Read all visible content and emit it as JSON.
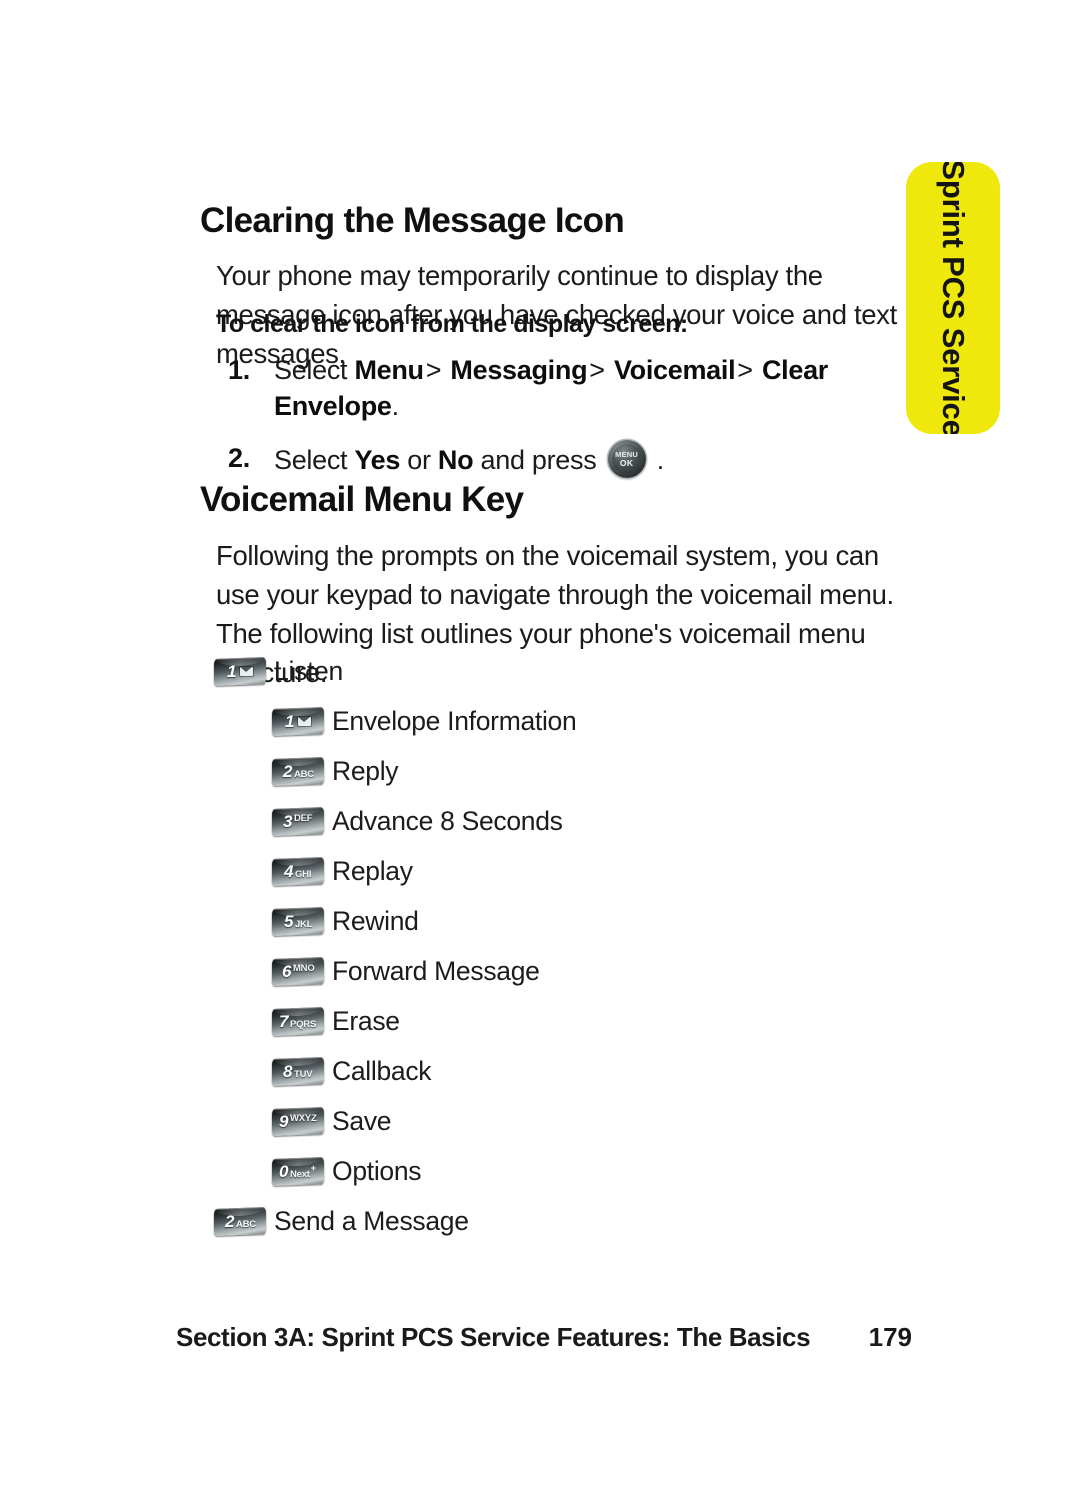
{
  "side_tab": {
    "label": "Sprint PCS Service",
    "background_color": "#efe80d",
    "text_color": "#141414"
  },
  "sections": {
    "clearing": {
      "heading": "Clearing the Message Icon",
      "paragraph": "Your phone may temporarily continue to display the message icon after you have checked your voice and text messages.",
      "lead_in": "To clear the icon from the display screen:",
      "steps": [
        {
          "number": "1.",
          "prefix": "Select ",
          "path": [
            "Menu",
            "Messaging",
            "Voicemail",
            "Clear Envelope"
          ],
          "separator": ">",
          "suffix": "."
        },
        {
          "number": "2.",
          "prefix": "Select ",
          "option_a": "Yes",
          "conjunction": " or ",
          "option_b": "No",
          "middle": " and press ",
          "key_icon": "menu-ok-key",
          "key_top_label": "MENU",
          "key_bottom_label": "OK",
          "suffix": " ."
        }
      ]
    },
    "voicemail": {
      "heading": "Voicemail Menu Key",
      "paragraph": "Following the prompts on the voicemail system, you can use your keypad to navigate through the voicemail menu. The following list outlines your phone's voicemail menu structure."
    }
  },
  "menu_tree": [
    {
      "level": 1,
      "key": {
        "digit": "1",
        "glyph": "envelope",
        "letters": ""
      },
      "label": "Listen"
    },
    {
      "level": 2,
      "key": {
        "digit": "1",
        "glyph": "envelope",
        "letters": ""
      },
      "label": "Envelope Information"
    },
    {
      "level": 2,
      "key": {
        "digit": "2",
        "glyph": "",
        "letters": "ABC"
      },
      "label": "Reply"
    },
    {
      "level": 2,
      "key": {
        "digit": "3",
        "glyph": "",
        "letters": "DEF",
        "raised": true
      },
      "label": "Advance 8 Seconds"
    },
    {
      "level": 2,
      "key": {
        "digit": "4",
        "glyph": "",
        "letters": "GHI"
      },
      "label": "Replay"
    },
    {
      "level": 2,
      "key": {
        "digit": "5",
        "glyph": "",
        "letters": "JKL"
      },
      "label": "Rewind"
    },
    {
      "level": 2,
      "key": {
        "digit": "6",
        "glyph": "",
        "letters": "MNO",
        "raised": true
      },
      "label": "Forward Message"
    },
    {
      "level": 2,
      "key": {
        "digit": "7",
        "glyph": "",
        "letters": "PQRS"
      },
      "label": "Erase"
    },
    {
      "level": 2,
      "key": {
        "digit": "8",
        "glyph": "",
        "letters": "TUV"
      },
      "label": "Callback"
    },
    {
      "level": 2,
      "key": {
        "digit": "9",
        "glyph": "",
        "letters": "WXYZ",
        "raised": true
      },
      "label": "Save"
    },
    {
      "level": 2,
      "key": {
        "digit": "0",
        "glyph": "",
        "letters": "Next",
        "plus": "+"
      },
      "label": "Options"
    },
    {
      "level": 1,
      "key": {
        "digit": "2",
        "glyph": "",
        "letters": "ABC"
      },
      "label": "Send a Message"
    }
  ],
  "footer": {
    "section": "Section 3A: Sprint PCS Service Features: The Basics",
    "page": "179"
  }
}
